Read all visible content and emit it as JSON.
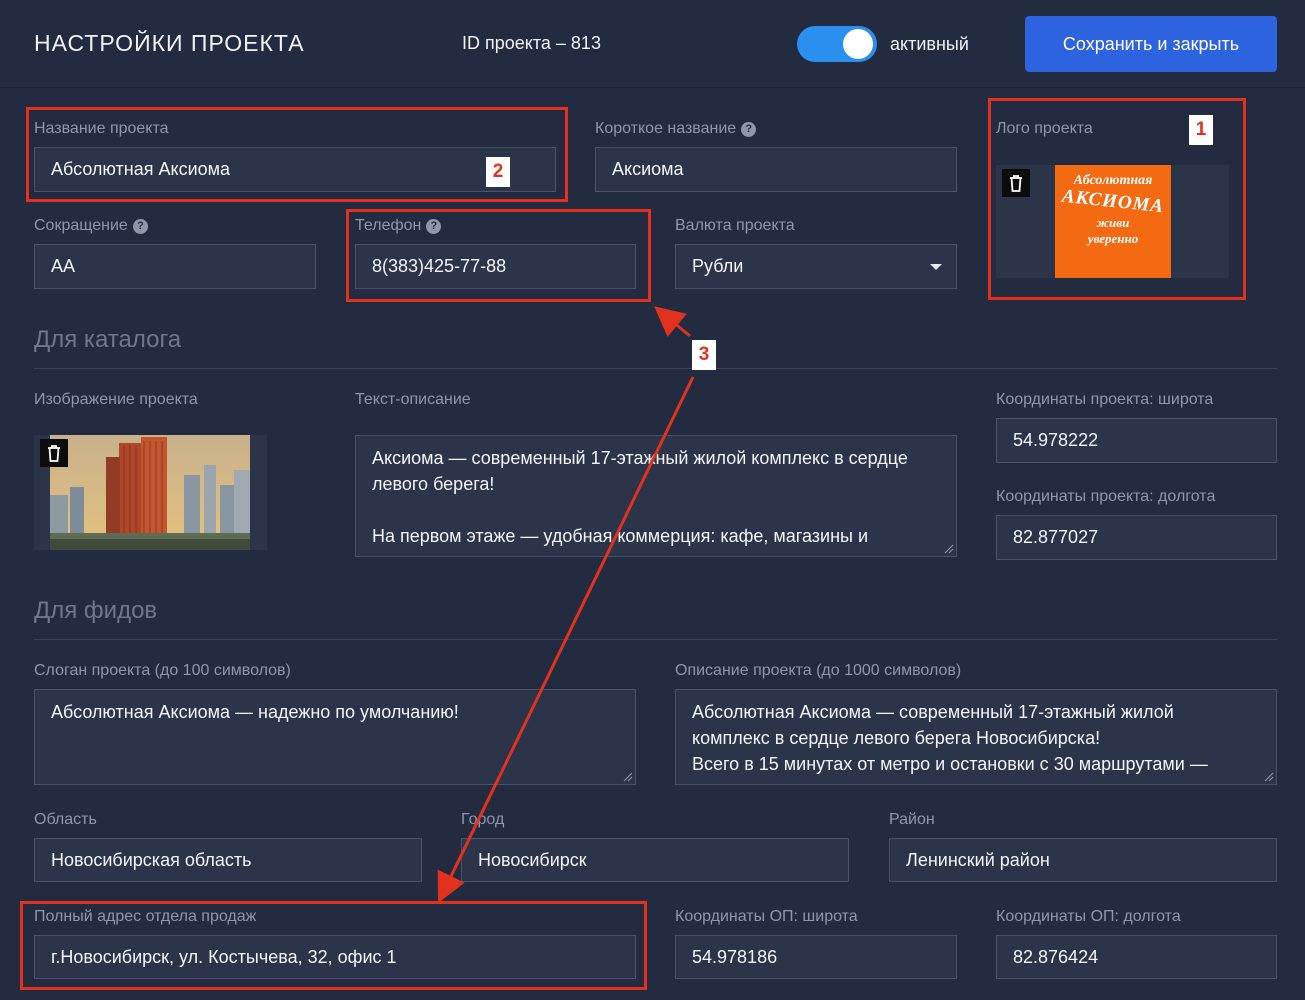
{
  "header": {
    "title": "НАСТРОЙКИ ПРОЕКТА",
    "project_id": "ID проекта – 813",
    "active_label": "активный",
    "active": true,
    "save_label": "Сохранить и закрыть"
  },
  "main": {
    "name_label": "Название проекта",
    "name_value": "Абсолютная Аксиома",
    "short_name_label": "Короткое название",
    "short_name_value": "Аксиома",
    "logo_label": "Лого проекта",
    "logo_text": {
      "line1": "Абсолютная",
      "line2": "АКСИОМА",
      "line3": "живи",
      "line4": "уверенно"
    },
    "abbr_label": "Сокращение",
    "abbr_value": "АА",
    "phone_label": "Телефон",
    "phone_value": "8(383)425-77-88",
    "currency_label": "Валюта проекта",
    "currency_value": "Рубли"
  },
  "catalog": {
    "section_title": "Для каталога",
    "image_label": "Изображение проекта",
    "desc_label": "Текст-описание",
    "desc_line1": "Аксиома — современный 17-этажный жилой комплекс в сердце",
    "desc_line2": "левого берега!",
    "desc_line3": "На первом этаже — удобная коммерция: кафе, магазины и",
    "lat_label": "Координаты проекта: широта",
    "lat_value": "54.978222",
    "lon_label": "Координаты проекта: долгота",
    "lon_value": "82.877027"
  },
  "feeds": {
    "section_title": "Для фидов",
    "slogan_label": "Слоган проекта (до 100 символов)",
    "slogan_value": "Абсолютная Аксиома — надежно по умолчанию!",
    "desc_label": "Описание проекта (до 1000 символов)",
    "desc_line1": "Абсолютная Аксиома — современный 17-этажный жилой",
    "desc_line2": "комплекс в сердце левого берега Новосибирска!",
    "desc_line3": "Всего в 15 минутах от метро и остановки с 30 маршрутами —",
    "region_label": "Область",
    "region_value": "Новосибирская область",
    "city_label": "Город",
    "city_value": "Новосибирск",
    "district_label": "Район",
    "district_value": "Ленинский район",
    "address_label": "Полный адрес отдела продаж",
    "address_value": "г.Новосибирск, ул. Костычева, 32, офис 1",
    "op_lat_label": "Координаты ОП: широта",
    "op_lat_value": "54.978186",
    "op_lon_label": "Координаты ОП: долгота",
    "op_lon_value": "82.876424"
  },
  "annotations": {
    "badge1": "1",
    "badge2": "2",
    "badge3": "3",
    "color": "#e2321e"
  },
  "colors": {
    "background": "#232b40",
    "field": "#2c3449",
    "accent": "#2e63e0",
    "toggle": "#2b8ff0",
    "logo": "#f36a12"
  }
}
